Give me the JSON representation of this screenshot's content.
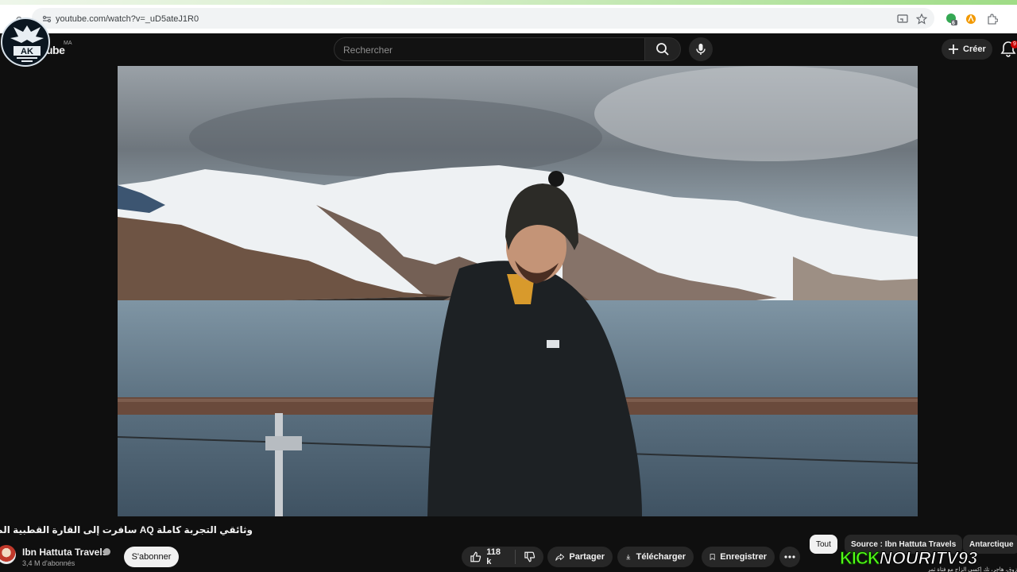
{
  "browser": {
    "url": "youtube.com/watch?v=_uD5ateJ1R0",
    "extension_badge": "6"
  },
  "header": {
    "logo_text": "ube",
    "country_code": "MA",
    "search_placeholder": "Rechercher",
    "create_label": "Créer",
    "notifications_count": "9"
  },
  "overlay": {
    "emblem_letters": "AK",
    "kick_brand": "KICK",
    "kick_handle": "NOURITV93",
    "ticker_text": "زوق، هاجر، تك إكسي الزاج مع فتاة ثمر"
  },
  "video": {
    "title": "وثائقي التجربة كاملة AQ سافرت إلى القارة القطبية المتجمدة أنتاركتيكا"
  },
  "channel": {
    "name": "Ibn Hattuta Travels",
    "subscribers": "3,4 M d'abonnés",
    "subscribe_label": "S'abonner"
  },
  "actions": {
    "likes": "118 k",
    "share": "Partager",
    "download": "Télécharger",
    "save": "Enregistrer"
  },
  "chips": [
    "Tout",
    "Source : Ibn Hattuta Travels",
    "Antarctique"
  ],
  "colors": {
    "accent_red": "#cc0000",
    "kick_green": "#53fc18",
    "background": "#0f0f0f"
  }
}
